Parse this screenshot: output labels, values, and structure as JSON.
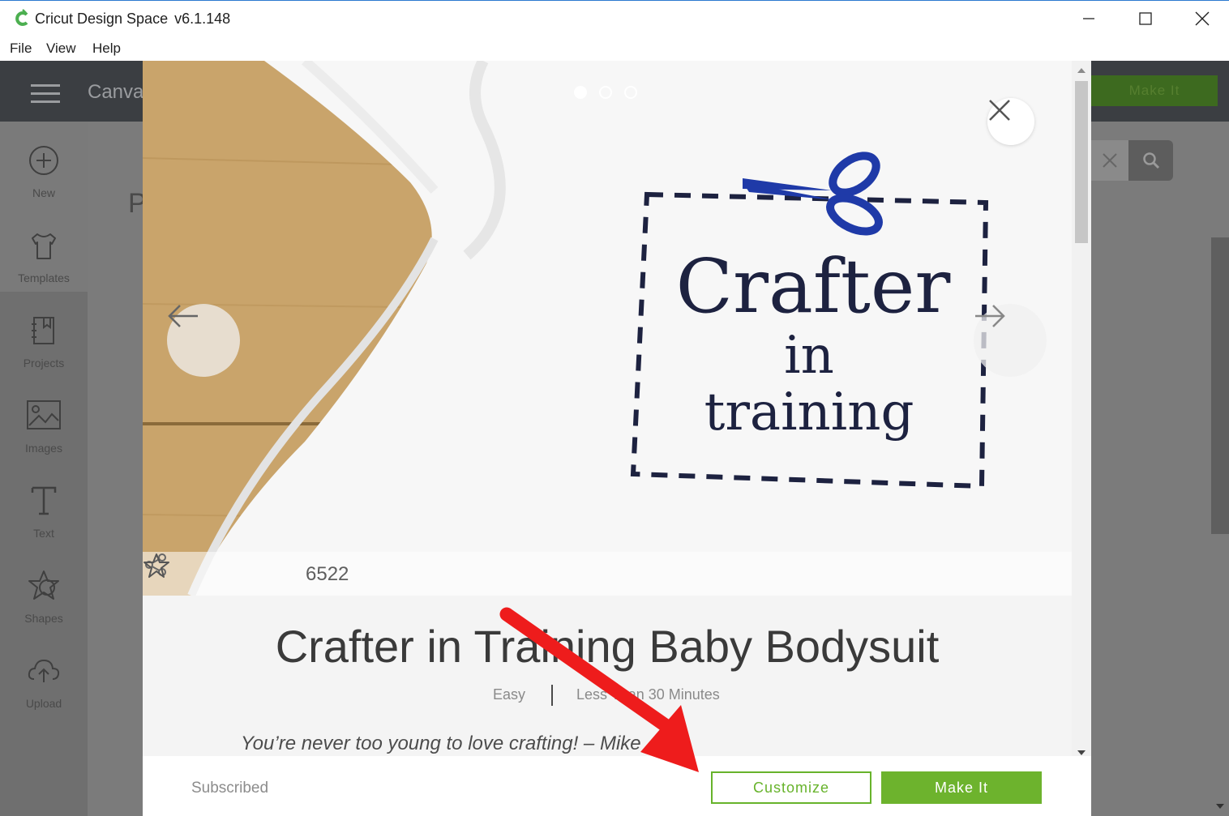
{
  "window": {
    "app_name": "Cricut Design Space",
    "version": "v6.1.148"
  },
  "menu": [
    "File",
    "View",
    "Help"
  ],
  "app": {
    "header_title": "Canva",
    "header_make_it": "Make It",
    "page_initial": "P",
    "sidebar": [
      {
        "label": "New",
        "icon": "plus-circle-icon"
      },
      {
        "label": "Templates",
        "icon": "tshirt-icon"
      },
      {
        "label": "Projects",
        "icon": "projects-book-icon"
      },
      {
        "label": "Images",
        "icon": "image-icon"
      },
      {
        "label": "Text",
        "icon": "text-icon"
      },
      {
        "label": "Shapes",
        "icon": "shapes-icon"
      },
      {
        "label": "Upload",
        "icon": "cloud-upload-icon"
      }
    ]
  },
  "project": {
    "carousel_pages": 3,
    "carousel_current": 1,
    "hero_text": [
      "Crafter",
      "in",
      "training"
    ],
    "favorites": "6522",
    "title": "Crafter in Training Baby Bodysuit",
    "difficulty": "Easy",
    "duration": "Less Than 30 Minutes",
    "tagline": "You’re never too young to love crafting! – Mike",
    "status": "Subscribed",
    "customize_label": "Customize",
    "make_it_label": "Make It"
  },
  "colors": {
    "accent_green": "#6db32d",
    "annotation_red": "#ee1c1c",
    "ink_navy": "#1d2240",
    "scissors_blue": "#1f3aa8"
  }
}
